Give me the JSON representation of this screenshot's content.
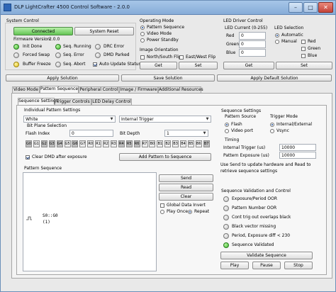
{
  "window": {
    "title": "DLP LightCrafter 4500 Control Software - 2.0.0",
    "buttons": {
      "minimize": "–",
      "maximize": "□",
      "close": "✕"
    }
  },
  "system_control": {
    "title": "System Control",
    "connected_button": "Connected",
    "reset_button": "System Reset",
    "firmware_label": "Firmware Version:",
    "firmware_value": "2.0.0",
    "indicators": [
      {
        "label": "Init Done",
        "state": "green"
      },
      {
        "label": "Seq. Running",
        "state": "green"
      },
      {
        "label": "DRC Error",
        "state": "gray"
      },
      {
        "label": "Forced Swap",
        "state": "gray"
      },
      {
        "label": "Seq. Error",
        "state": "gray"
      },
      {
        "label": "DMD Parked",
        "state": "gray"
      },
      {
        "label": "Buffer Freeze",
        "state": "yellow"
      },
      {
        "label": "Seq. Abort",
        "state": "gray"
      }
    ],
    "auto_update_label": "Auto Update Status",
    "auto_update_checked": true
  },
  "operating_mode": {
    "title": "Operating Mode",
    "options": [
      "Pattern Sequence",
      "Video Mode",
      "Power Standby"
    ],
    "selected": 0,
    "orientation_title": "Image Orientation",
    "north_south_label": "North/South Flip",
    "east_west_label": "East/West Flip",
    "get_label": "Get",
    "set_label": "Set"
  },
  "led_driver": {
    "title": "LED Driver Control",
    "current_title": "LED Current (0-255)",
    "fields": [
      {
        "label": "Red",
        "value": "0"
      },
      {
        "label": "Green",
        "value": "0"
      },
      {
        "label": "Blue",
        "value": "0"
      }
    ],
    "selection_title": "LED Selection",
    "modes": [
      "Automatic",
      "Manual"
    ],
    "mode_selected": 0,
    "colors": [
      "Red",
      "Green",
      "Blue"
    ],
    "get_label": "Get",
    "set_label": "Set"
  },
  "apply_bar": {
    "apply": "Apply Solution",
    "save": "Save Solution",
    "apply_default": "Apply Default Solution"
  },
  "main_tabs": [
    "Video Mode",
    "Pattern Sequence",
    "Peripheral Control",
    "Image / Firmware",
    "Additional Resources"
  ],
  "main_tab_active": 1,
  "sub_tabs": [
    "Sequence Settings",
    "Trigger Controls",
    "LED Delay Control"
  ],
  "sub_tab_active": 0,
  "individual": {
    "title": "Individual Pattern Settings",
    "color_select": "White",
    "trigger_select": "Internal Trigger",
    "bitplane_title": "Bit Plane Selection",
    "flash_index_label": "Flash Index",
    "flash_index_value": "0",
    "bit_depth_label": "Bit Depth",
    "bit_depth_value": "1",
    "bits": [
      {
        "label": "G0",
        "on": true
      },
      {
        "label": "G1",
        "on": false
      },
      {
        "label": "G2",
        "on": true
      },
      {
        "label": "G3",
        "on": true
      },
      {
        "label": "G4",
        "on": true
      },
      {
        "label": "G5",
        "on": false
      },
      {
        "label": "G6",
        "on": true
      },
      {
        "label": "G7",
        "on": false
      },
      {
        "label": "R0",
        "on": false
      },
      {
        "label": "R1",
        "on": false
      },
      {
        "label": "R2",
        "on": false
      },
      {
        "label": "R3",
        "on": false
      },
      {
        "label": "R4",
        "on": true
      },
      {
        "label": "R5",
        "on": true
      },
      {
        "label": "R6",
        "on": true
      },
      {
        "label": "R7",
        "on": false
      },
      {
        "label": "B0",
        "on": false
      },
      {
        "label": "B1",
        "on": false
      },
      {
        "label": "B2",
        "on": false
      },
      {
        "label": "B3",
        "on": false
      },
      {
        "label": "B4",
        "on": false
      },
      {
        "label": "B5",
        "on": false
      },
      {
        "label": "B6",
        "on": false
      },
      {
        "label": "B7",
        "on": true
      }
    ],
    "clear_dmd_label": "Clear DMD after exposure",
    "clear_dmd_checked": true,
    "add_pattern_label": "Add Pattern to Sequence"
  },
  "pattern_sequence": {
    "title": "Pattern Sequence",
    "entry_line1": "S0::G0",
    "entry_line2": "(1)",
    "read_label": "Read",
    "clear_label": "Clear",
    "send_label": "Send",
    "global_invert_label": "Global Data Invert",
    "play_once_label": "Play Once",
    "repeat_label": "Repeat",
    "repeat_selected": true
  },
  "sequence_settings": {
    "title": "Sequence Settings",
    "pattern_source_title": "Pattern Source",
    "sources": [
      "Flash",
      "Video port"
    ],
    "source_selected": 0,
    "trigger_mode_title": "Trigger Mode",
    "trigger_modes": [
      "Internal/External",
      "Vsync"
    ],
    "trigger_selected": 0,
    "timing_title": "Timing",
    "period_label": "Internal Trigger (us)",
    "period_value": "10000",
    "exposure_label": "Pattern Exposure (us)",
    "exposure_value": "10000",
    "help_text": "Use Send to update hardware and Read to retrieve sequence settings"
  },
  "validation": {
    "title": "Sequence Validation and Control",
    "items": [
      {
        "label": "Exposure/Period OOR",
        "state": "gray"
      },
      {
        "label": "Pattern Number OOR",
        "state": "gray"
      },
      {
        "label": "Cont trig out overlaps black",
        "state": "gray"
      },
      {
        "label": "Black vector missing",
        "state": "gray"
      },
      {
        "label": "Period, Exposure diff < 230",
        "state": "gray"
      },
      {
        "label": "Sequence Validated",
        "state": "green"
      }
    ],
    "validate_label": "Validate Sequence",
    "play_label": "Play",
    "pause_label": "Pause",
    "stop_label": "Stop"
  }
}
